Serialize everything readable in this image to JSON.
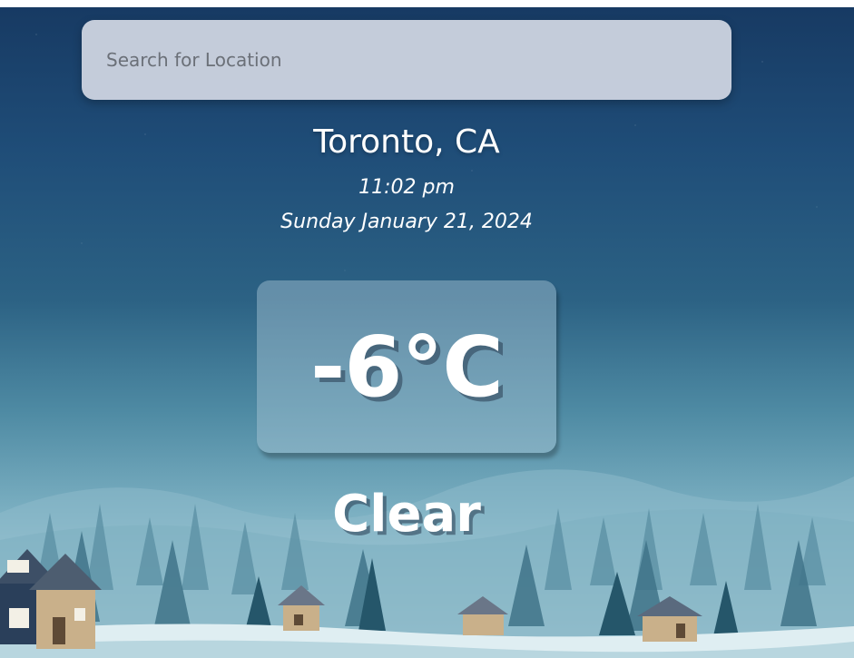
{
  "search": {
    "placeholder": "Search for Location",
    "value": ""
  },
  "weather": {
    "location": "Toronto, CA",
    "time": "11:02 pm",
    "date": "Sunday January 21, 2024",
    "temperature": "-6°C",
    "condition": "Clear"
  },
  "colors": {
    "sky_top": "#173a63",
    "sky_bottom": "#cfe2e7",
    "search_bg": "#cdd4e0",
    "text": "#ffffff"
  }
}
